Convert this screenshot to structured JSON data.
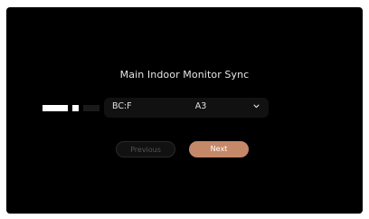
{
  "dialog": {
    "title": "Main Indoor Monitor Sync"
  },
  "device_select": {
    "value_prefix": "BC:F",
    "value_suffix": "A3",
    "icon": "chevron-down-icon"
  },
  "buttons": {
    "previous_label": "Previous",
    "next_label": "Next"
  },
  "colors": {
    "background": "#000000",
    "accent": "#c5896a",
    "select_bg": "#111111",
    "disabled_text": "#555555"
  }
}
